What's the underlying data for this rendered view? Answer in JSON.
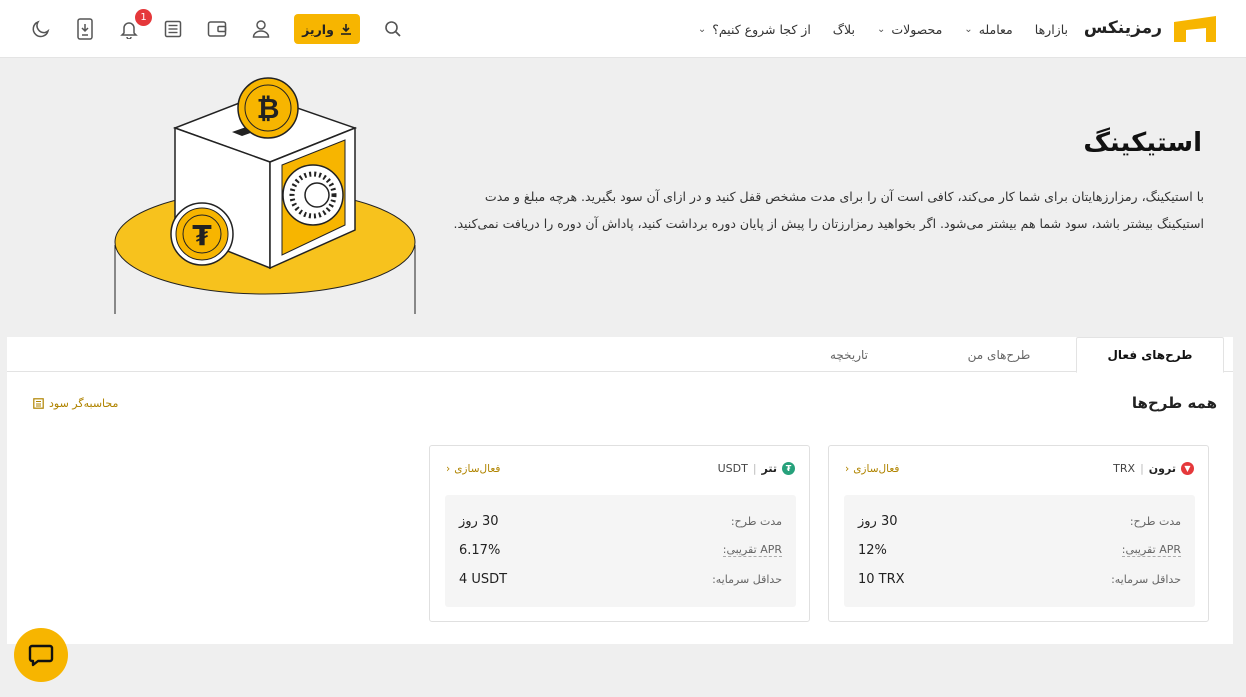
{
  "header": {
    "logo_text": "رمزینکس",
    "nav": [
      {
        "label": "بازارها",
        "has_dropdown": false
      },
      {
        "label": "معامله",
        "has_dropdown": true
      },
      {
        "label": "محصولات",
        "has_dropdown": true
      },
      {
        "label": "بلاگ",
        "has_dropdown": false
      },
      {
        "label": "از کجا شروع کنیم؟",
        "has_dropdown": true
      }
    ],
    "deposit_label": "واریز",
    "notification_count": "1",
    "icons": [
      "search-icon",
      "user-icon",
      "wallet-icon",
      "orders-icon",
      "bell-icon",
      "download-app-icon",
      "moon-icon"
    ]
  },
  "hero": {
    "title": "استیکینگ",
    "description": "با استیکینگ، رمزارزهایتان برای شما کار می‌کند، کافی است آن را برای مدت مشخص قفل کنید و در ازای آن سود بگیرید. هرچه مبلغ و مدت استیکینگ بیشتر باشد، سود شما هم بیشتر می‌شود. اگر بخواهید رمزارزتان را پیش از پایان دوره برداشت کنید، پاداش آن دوره را دریافت نمی‌کنید."
  },
  "tabs": [
    {
      "label": "طرح‌های فعال",
      "active": true
    },
    {
      "label": "طرح‌های من",
      "active": false
    },
    {
      "label": "تاریخچه",
      "active": false
    }
  ],
  "section": {
    "title": "همه طرح‌ها",
    "calculator_label": "محاسبه‌گر سود"
  },
  "plans": [
    {
      "coin_name": "ترون",
      "symbol": "TRX",
      "color": "#e5383b",
      "activate_label": "فعال‌سازی",
      "duration_label": "مدت طرح:",
      "duration_value": "30 روز",
      "apr_label": "APR تقریبی:",
      "apr_value": "12%",
      "min_label": "حداقل سرمایه:",
      "min_value": "10 TRX"
    },
    {
      "coin_name": "تتر",
      "symbol": "USDT",
      "color": "#26a17b",
      "activate_label": "فعال‌سازی",
      "duration_label": "مدت طرح:",
      "duration_value": "30 روز",
      "apr_label": "APR تقریبی:",
      "apr_value": "6.17%",
      "min_label": "حداقل سرمایه:",
      "min_value": "4 USDT"
    }
  ],
  "colors": {
    "brand": "#f7b500",
    "link": "#b08400",
    "background": "#efefef"
  }
}
